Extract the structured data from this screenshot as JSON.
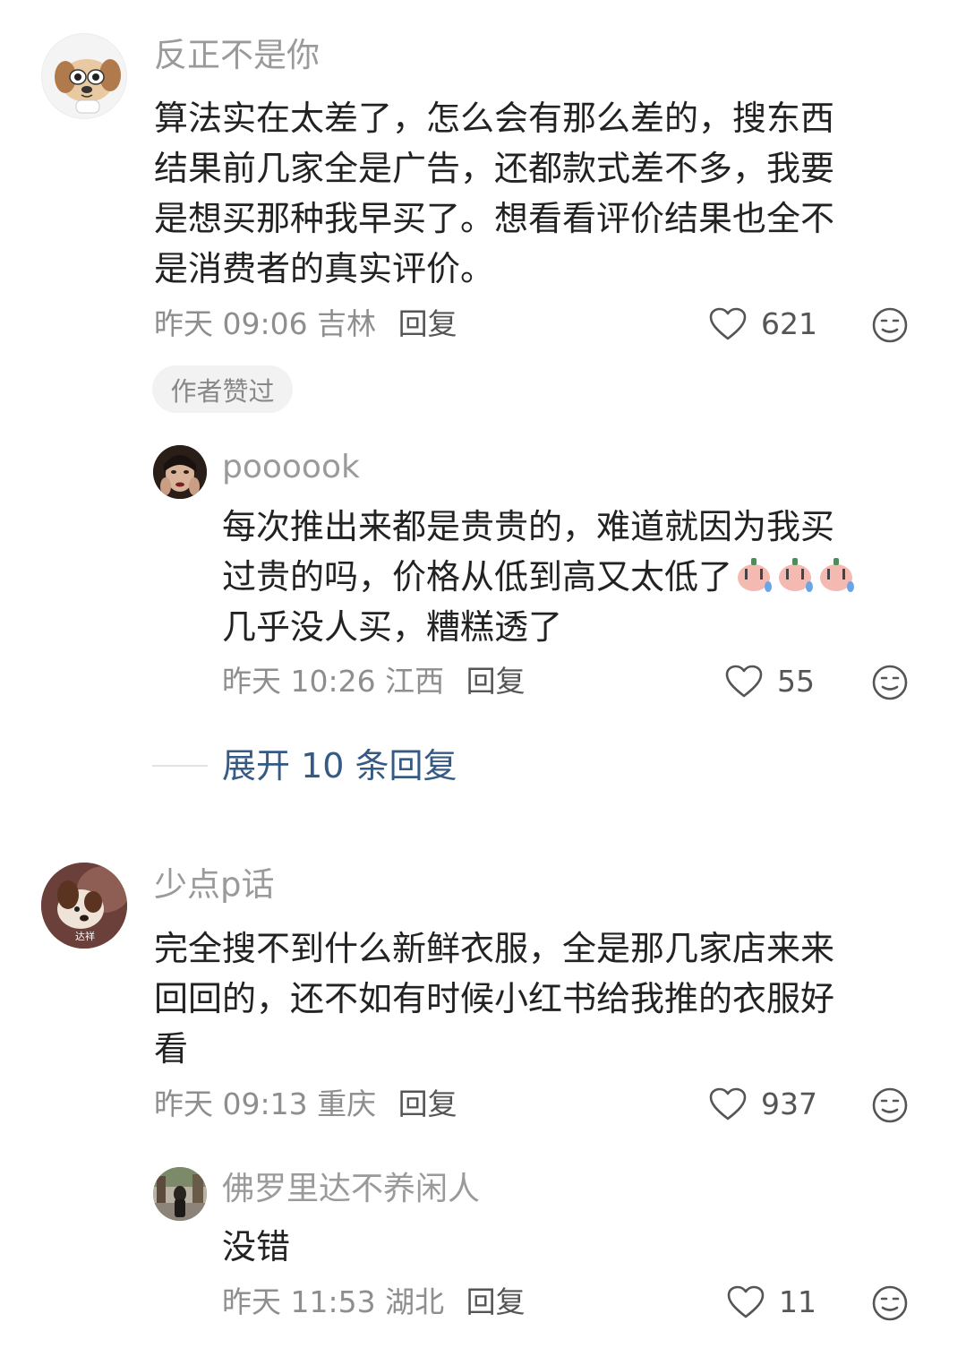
{
  "comments": [
    {
      "username": "反正不是你",
      "lines": [
        "算法实在太差了，怎么会有那么差的，搜东西",
        "结果前几家全是广告，还都款式差不多，我要",
        "是想买那种我早买了。想看看评价结果也全不",
        "是消费者的真实评价。"
      ],
      "time": "昨天 09:06",
      "location": "吉林",
      "reply_label": "回复",
      "likes": "621",
      "badge": "作者赞过",
      "avatar_icon": "cartoon-dog-avatar"
    },
    {
      "username": "poooook",
      "lines": [
        "每次推出来都是贵贵的，难道就因为我买",
        "过贵的吗，价格从低到高又太低了",
        "几乎没人买，糟糕透了"
      ],
      "time": "昨天 10:26",
      "location": "江西",
      "reply_label": "回复",
      "likes": "55",
      "avatar_icon": "person-photo-avatar"
    },
    {
      "username": "少点p话",
      "lines": [
        "完全搜不到什么新鲜衣服，全是那几家店来来",
        "回回的，还不如有时候小红书给我推的衣服好",
        "看"
      ],
      "time": "昨天 09:13",
      "location": "重庆",
      "reply_label": "回复",
      "likes": "937",
      "avatar_text": "达祥",
      "avatar_icon": "dog-photo-avatar"
    },
    {
      "username": "佛罗里达不养闲人",
      "lines": [
        "没错"
      ],
      "time": "昨天 11:53",
      "location": "湖北",
      "reply_label": "回复",
      "likes": "11",
      "avatar_icon": "street-photo-avatar"
    }
  ],
  "expand_replies": "展开 10 条回复",
  "colors": {
    "username": "#9a9a9a",
    "text": "#222222",
    "meta": "#8e8e8e",
    "expand": "#355a86",
    "badge_bg": "#f2f2f2"
  }
}
